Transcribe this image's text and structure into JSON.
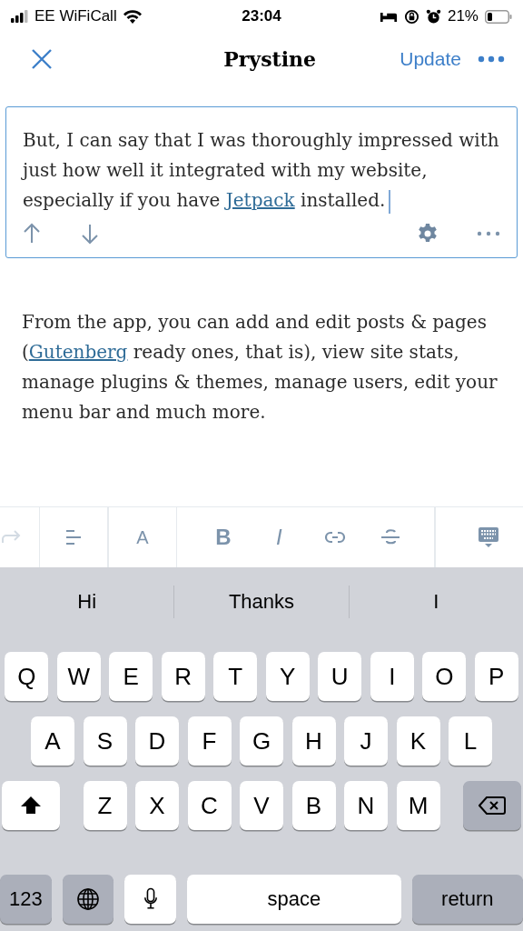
{
  "status_bar": {
    "carrier": "EE WiFiCall",
    "time": "23:04",
    "battery": "21%"
  },
  "nav": {
    "title": "Prystine",
    "action": "Update"
  },
  "editor": {
    "selected_block": {
      "text": "But, I can say that I was thoroughly impressed with just how well it integrated with my website, especially if you have ",
      "link": "Jetpack",
      "after": " installed."
    },
    "paragraph": {
      "before": "From the app, you can add and edit posts & pages (",
      "link": "Gutenberg",
      "after": " ready ones, that is), view site stats, manage plugins & themes, manage users, edit your menu bar and much more."
    }
  },
  "format_toolbar": [
    {
      "kind": "redo",
      "disabled": true
    },
    {
      "kind": "align",
      "disabled": false
    },
    {
      "kind": "heading",
      "label": "A",
      "disabled": false
    },
    {
      "kind": "bold",
      "label": "B",
      "disabled": false
    },
    {
      "kind": "italic",
      "label": "I",
      "disabled": false
    },
    {
      "kind": "link",
      "disabled": false
    },
    {
      "kind": "strike",
      "disabled": false
    },
    {
      "kind": "hide-keyboard",
      "disabled": false
    }
  ],
  "keyboard": {
    "suggestions": [
      "Hi",
      "Thanks",
      "I"
    ],
    "rows": [
      [
        "Q",
        "W",
        "E",
        "R",
        "T",
        "Y",
        "U",
        "I",
        "O",
        "P"
      ],
      [
        "A",
        "S",
        "D",
        "F",
        "G",
        "H",
        "J",
        "K",
        "L"
      ],
      [
        "Z",
        "X",
        "C",
        "V",
        "B",
        "N",
        "M"
      ]
    ],
    "numbers_key": "123",
    "space_key": "space",
    "return_key": "return"
  }
}
